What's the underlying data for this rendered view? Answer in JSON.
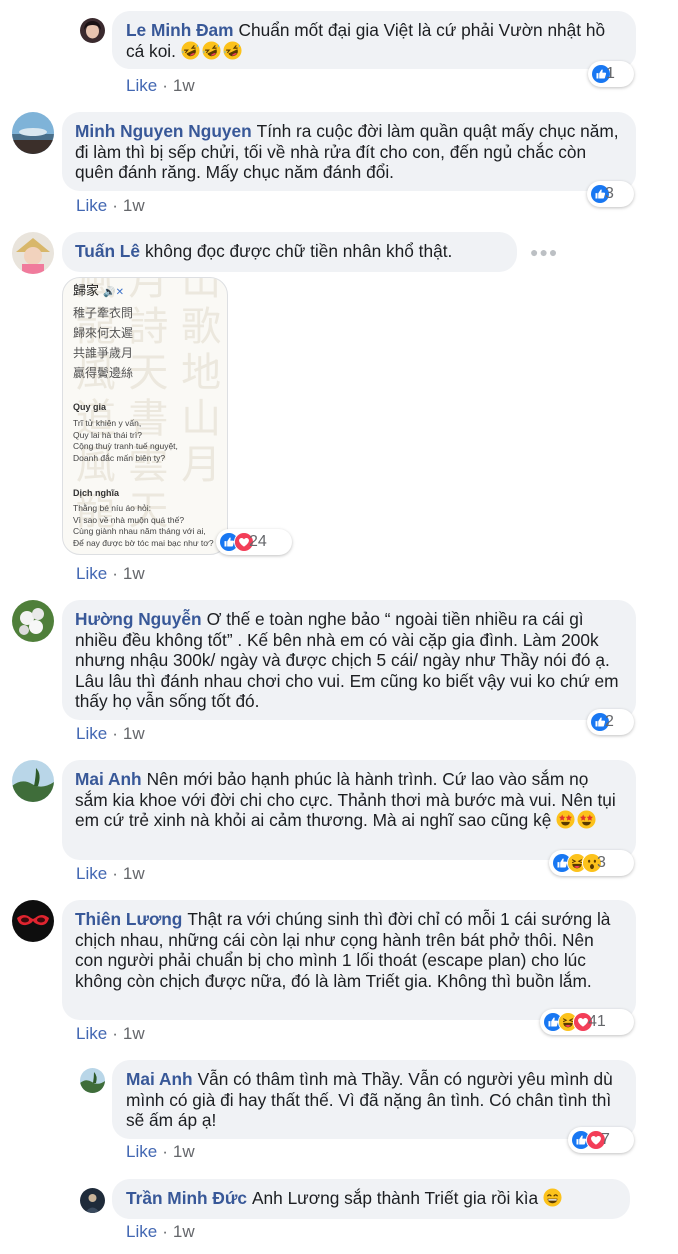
{
  "like_label": "Like",
  "separator": "·",
  "comments": [
    {
      "author": "Le Minh Đam",
      "text": "Chuẩn mốt đại gia Việt là cứ phải Vườn nhật hồ cá koi.",
      "time": "1w",
      "reactions": [
        "like"
      ],
      "count": "1",
      "emojis": [
        "rofl",
        "rofl",
        "rofl"
      ]
    },
    {
      "author": "Minh Nguyen Nguyen",
      "text": "Tính ra cuộc đời làm quần quật mấy chục năm, đi làm thì bị sếp chửi, tối về nhà rửa đít cho con, đến ngủ chắc còn quên đánh răng. Mấy chục năm đánh đổi.",
      "time": "1w",
      "reactions": [
        "like"
      ],
      "count": "3"
    },
    {
      "author": "Tuấn Lê",
      "text": "không đọc được chữ tiền nhân khổ thật.",
      "time": "1w",
      "reactions": [
        "like",
        "love"
      ],
      "count": "24",
      "attachment": {
        "title": "歸家",
        "lines_cn": [
          "稚子牽衣問",
          "歸來何太遲",
          "共誰爭歲月",
          "贏得鬢邊絲"
        ],
        "heading1": "Quy gia",
        "lines_vi": [
          "Trĩ tử khiên y vấn,",
          "Quy lai hà thái trì?",
          "Cộng thuỳ tranh tuế nguyệt,",
          "Doanh đắc mấn biên ty?"
        ],
        "heading2": "Dịch nghĩa",
        "lines_tr": [
          "Thằng bé níu áo hỏi:",
          "Vì sao về nhà muộn quá thế?",
          "Cùng giành nhau năm tháng với ai,",
          "Để nay được bờ tóc mai bạc như tơ?"
        ]
      }
    },
    {
      "author": "Hường Nguyễn",
      "text": "Ơ thế e toàn nghe bảo “ ngoài tiền nhiều ra cái gì nhiều đều không tốt” . Kế bên nhà em có vài cặp gia đình. Làm 200k nhưng nhậu 300k/ ngày và được chịch 5 cái/ ngày như Thầy nói đó ạ. Lâu lâu thì đánh nhau chơi cho vui. Em cũng ko biết vậy vui ko chứ em thấy họ vẫn sống tốt đó.",
      "time": "1w",
      "reactions": [
        "like"
      ],
      "count": "2"
    },
    {
      "author": "Mai Anh",
      "text": "Nên mới bảo hạnh phúc là hành trình. Cứ lao vào sắm nọ sắm kia khoe với đời chi cho cực. Thảnh thơi mà bước mà vui. Nên tụi em cứ trẻ xinh nà khỏi ai cảm thương. Mà ai nghĩ sao cũng kệ",
      "time": "1w",
      "reactions": [
        "like",
        "haha",
        "wow"
      ],
      "count": "3",
      "emojis": [
        "star-struck",
        "star-struck"
      ]
    },
    {
      "author": "Thiên Lương",
      "text": "Thật ra với chúng sinh thì đời chỉ có mỗi 1 cái sướng là chịch nhau, những cái còn lại như cọng hành trên bát phở thôi. Nên con người phải chuẩn bị cho mình 1 lối thoát (escape plan) cho lúc không còn chịch được nữa, đó là làm Triết gia. Không thì buồn lắm.",
      "time": "1w",
      "reactions": [
        "like",
        "haha",
        "love"
      ],
      "count": "41"
    },
    {
      "author": "Mai Anh",
      "text": "Vẫn có thâm tình mà Thầy. Vẫn có người yêu mình dù mình có già đi hay thất thế. Vì đã nặng ân tình. Có chân tình thì sẽ ấm áp ạ!",
      "time": "1w",
      "reactions": [
        "like",
        "love"
      ],
      "count": "7"
    },
    {
      "author": "Trần Minh Đức",
      "text": "Anh Lương sắp thành Triết gia rồi kìa",
      "time": "1w",
      "emojis": [
        "grin"
      ]
    }
  ],
  "colors": {
    "author": "#385898",
    "like_link": "#4267b2",
    "meta": "#65676b",
    "bubble": "#f0f2f5",
    "like_blue": "#1877f2",
    "love_red": "#f33e58",
    "emoji_yellow": "#fcc21b"
  }
}
